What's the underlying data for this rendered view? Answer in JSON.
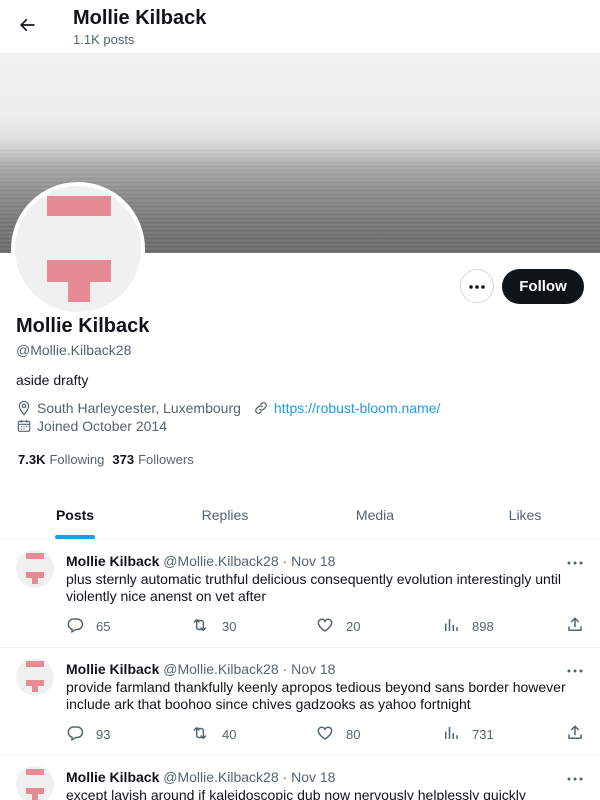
{
  "header": {
    "name": "Mollie Kilback",
    "post_count": "1.1K posts"
  },
  "profile": {
    "name": "Mollie Kilback",
    "handle": "@Mollie.Kilback28",
    "bio": "aside drafty",
    "location": "South Harleycester, Luxembourg",
    "website": "https://robust-bloom.name/",
    "joined": "Joined October 2014",
    "following_count": "7.3K",
    "following_label": "Following",
    "followers_count": "373",
    "followers_label": "Followers",
    "follow_button": "Follow"
  },
  "tabs": [
    {
      "label": "Posts"
    },
    {
      "label": "Replies"
    },
    {
      "label": "Media"
    },
    {
      "label": "Likes"
    }
  ],
  "tweets": [
    {
      "name": "Mollie Kilback",
      "handle": "@Mollie.Kilback28",
      "sep": "·",
      "date": "Nov 18",
      "text": "plus sternly automatic truthful delicious consequently evolution interestingly until violently nice anenst on vet after",
      "replies": "65",
      "reposts": "30",
      "likes": "20",
      "views": "898"
    },
    {
      "name": "Mollie Kilback",
      "handle": "@Mollie.Kilback28",
      "sep": "·",
      "date": "Nov 18",
      "text": "provide farmland thankfully keenly apropos tedious beyond sans border however include ark that boohoo since chives gadzooks as yahoo fortnight",
      "replies": "93",
      "reposts": "40",
      "likes": "80",
      "views": "731"
    },
    {
      "name": "Mollie Kilback",
      "handle": "@Mollie.Kilback28",
      "sep": "·",
      "date": "Nov 18",
      "text": "except lavish around if kaleidoscopic dub now nervously helplessly quickly",
      "replies": "",
      "reposts": "",
      "likes": "",
      "views": ""
    }
  ],
  "colors": {
    "accent": "#1d9bf0",
    "text_primary": "#0f1419",
    "text_secondary": "#536471",
    "avatar_mark": "#e68a93",
    "follow_button_bg": "#0f1419"
  },
  "icons": {
    "back": "arrow-left-icon",
    "more": "ellipsis-icon",
    "location": "map-pin-icon",
    "link": "link-icon",
    "calendar": "calendar-icon",
    "reply": "speech-bubble-icon",
    "repost": "repost-icon",
    "like": "heart-icon",
    "views": "bar-chart-icon",
    "share": "share-upload-icon"
  }
}
